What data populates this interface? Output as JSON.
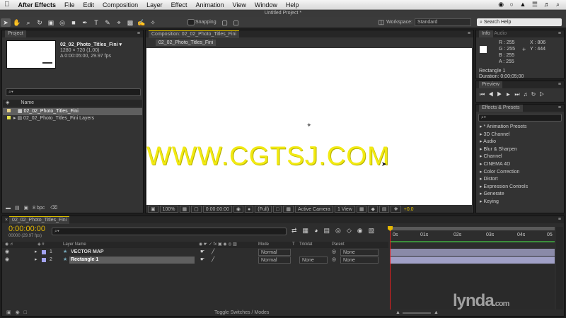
{
  "menu": {
    "app": "After Effects",
    "items": [
      "File",
      "Edit",
      "Composition",
      "Layer",
      "Effect",
      "Animation",
      "View",
      "Window",
      "Help"
    ]
  },
  "window_title": "Untitled Project *",
  "toolbar": {
    "snapping_label": "Snapping",
    "workspace_label": "Workspace:",
    "workspace_value": "Standard",
    "search_placeholder": "Search Help"
  },
  "project": {
    "tab": "Project",
    "comp_name": "02_02_Photo_Titles_Fini ▾",
    "comp_dims": "1280 × 720 (1.00)",
    "comp_duration": "Δ 0:00:05:00, 29.97 fps",
    "search_placeholder": "⌕▾",
    "col_name": "Name",
    "items": [
      "02_02_Photo_Titles_Fini",
      "02_02_Photo_Titles_Fini Layers"
    ],
    "bpc": "8 bpc"
  },
  "composition": {
    "tab": "Composition: 02_02_Photo_Titles_Fini",
    "subtab": "02_02_Photo_Titles_Fini",
    "watermark": "WWW.CGTSJ.COM",
    "zoom": "100%",
    "timecode": "0:00:00:00",
    "resolution": "(Full)",
    "camera": "Active Camera",
    "view": "1 View",
    "exposure": "+0.0"
  },
  "info": {
    "tabs": [
      "Info",
      "Audio"
    ],
    "r": "R : 255",
    "g": "G : 255",
    "b": "B : 255",
    "a": "A : 255",
    "x": "X : 806",
    "y": "Y : 444",
    "selection": "Rectangle 1",
    "duration": "Duration: 0;00;05;00"
  },
  "preview": {
    "tab": "Preview"
  },
  "effects": {
    "tab": "Effects & Presets",
    "items": [
      "▸ * Animation Presets",
      "▸ 3D Channel",
      "▸ Audio",
      "▸ Blur & Sharpen",
      "▸ Channel",
      "▸ CINEMA 4D",
      "▸ Color Correction",
      "▸ Distort",
      "▸ Expression Controls",
      "▸ Generate",
      "▸ Keying"
    ]
  },
  "timeline": {
    "tab": "02_02_Photo_Titles_Fini",
    "timecode": "0:00:00:00",
    "frames": "00000 (29.97 fps)",
    "search_placeholder": "⌕▾",
    "col_layer_name": "Layer Name",
    "col_mode": "Mode",
    "col_t": "T",
    "col_trkmat": "TrkMat",
    "col_parent": "Parent",
    "ruler": [
      "0s",
      "01s",
      "02s",
      "03s",
      "04s",
      "05"
    ],
    "layers": [
      {
        "num": "1",
        "name": "VECTOR MAP",
        "mode": "Normal",
        "trkmat": "",
        "parent": "None",
        "color": "#a3a3f0"
      },
      {
        "num": "2",
        "name": "Rectangle 1",
        "mode": "Normal",
        "trkmat": "None",
        "parent": "None",
        "color": "#a3a3f0"
      }
    ]
  },
  "branding": "lynda",
  "branding_suffix": ".com"
}
